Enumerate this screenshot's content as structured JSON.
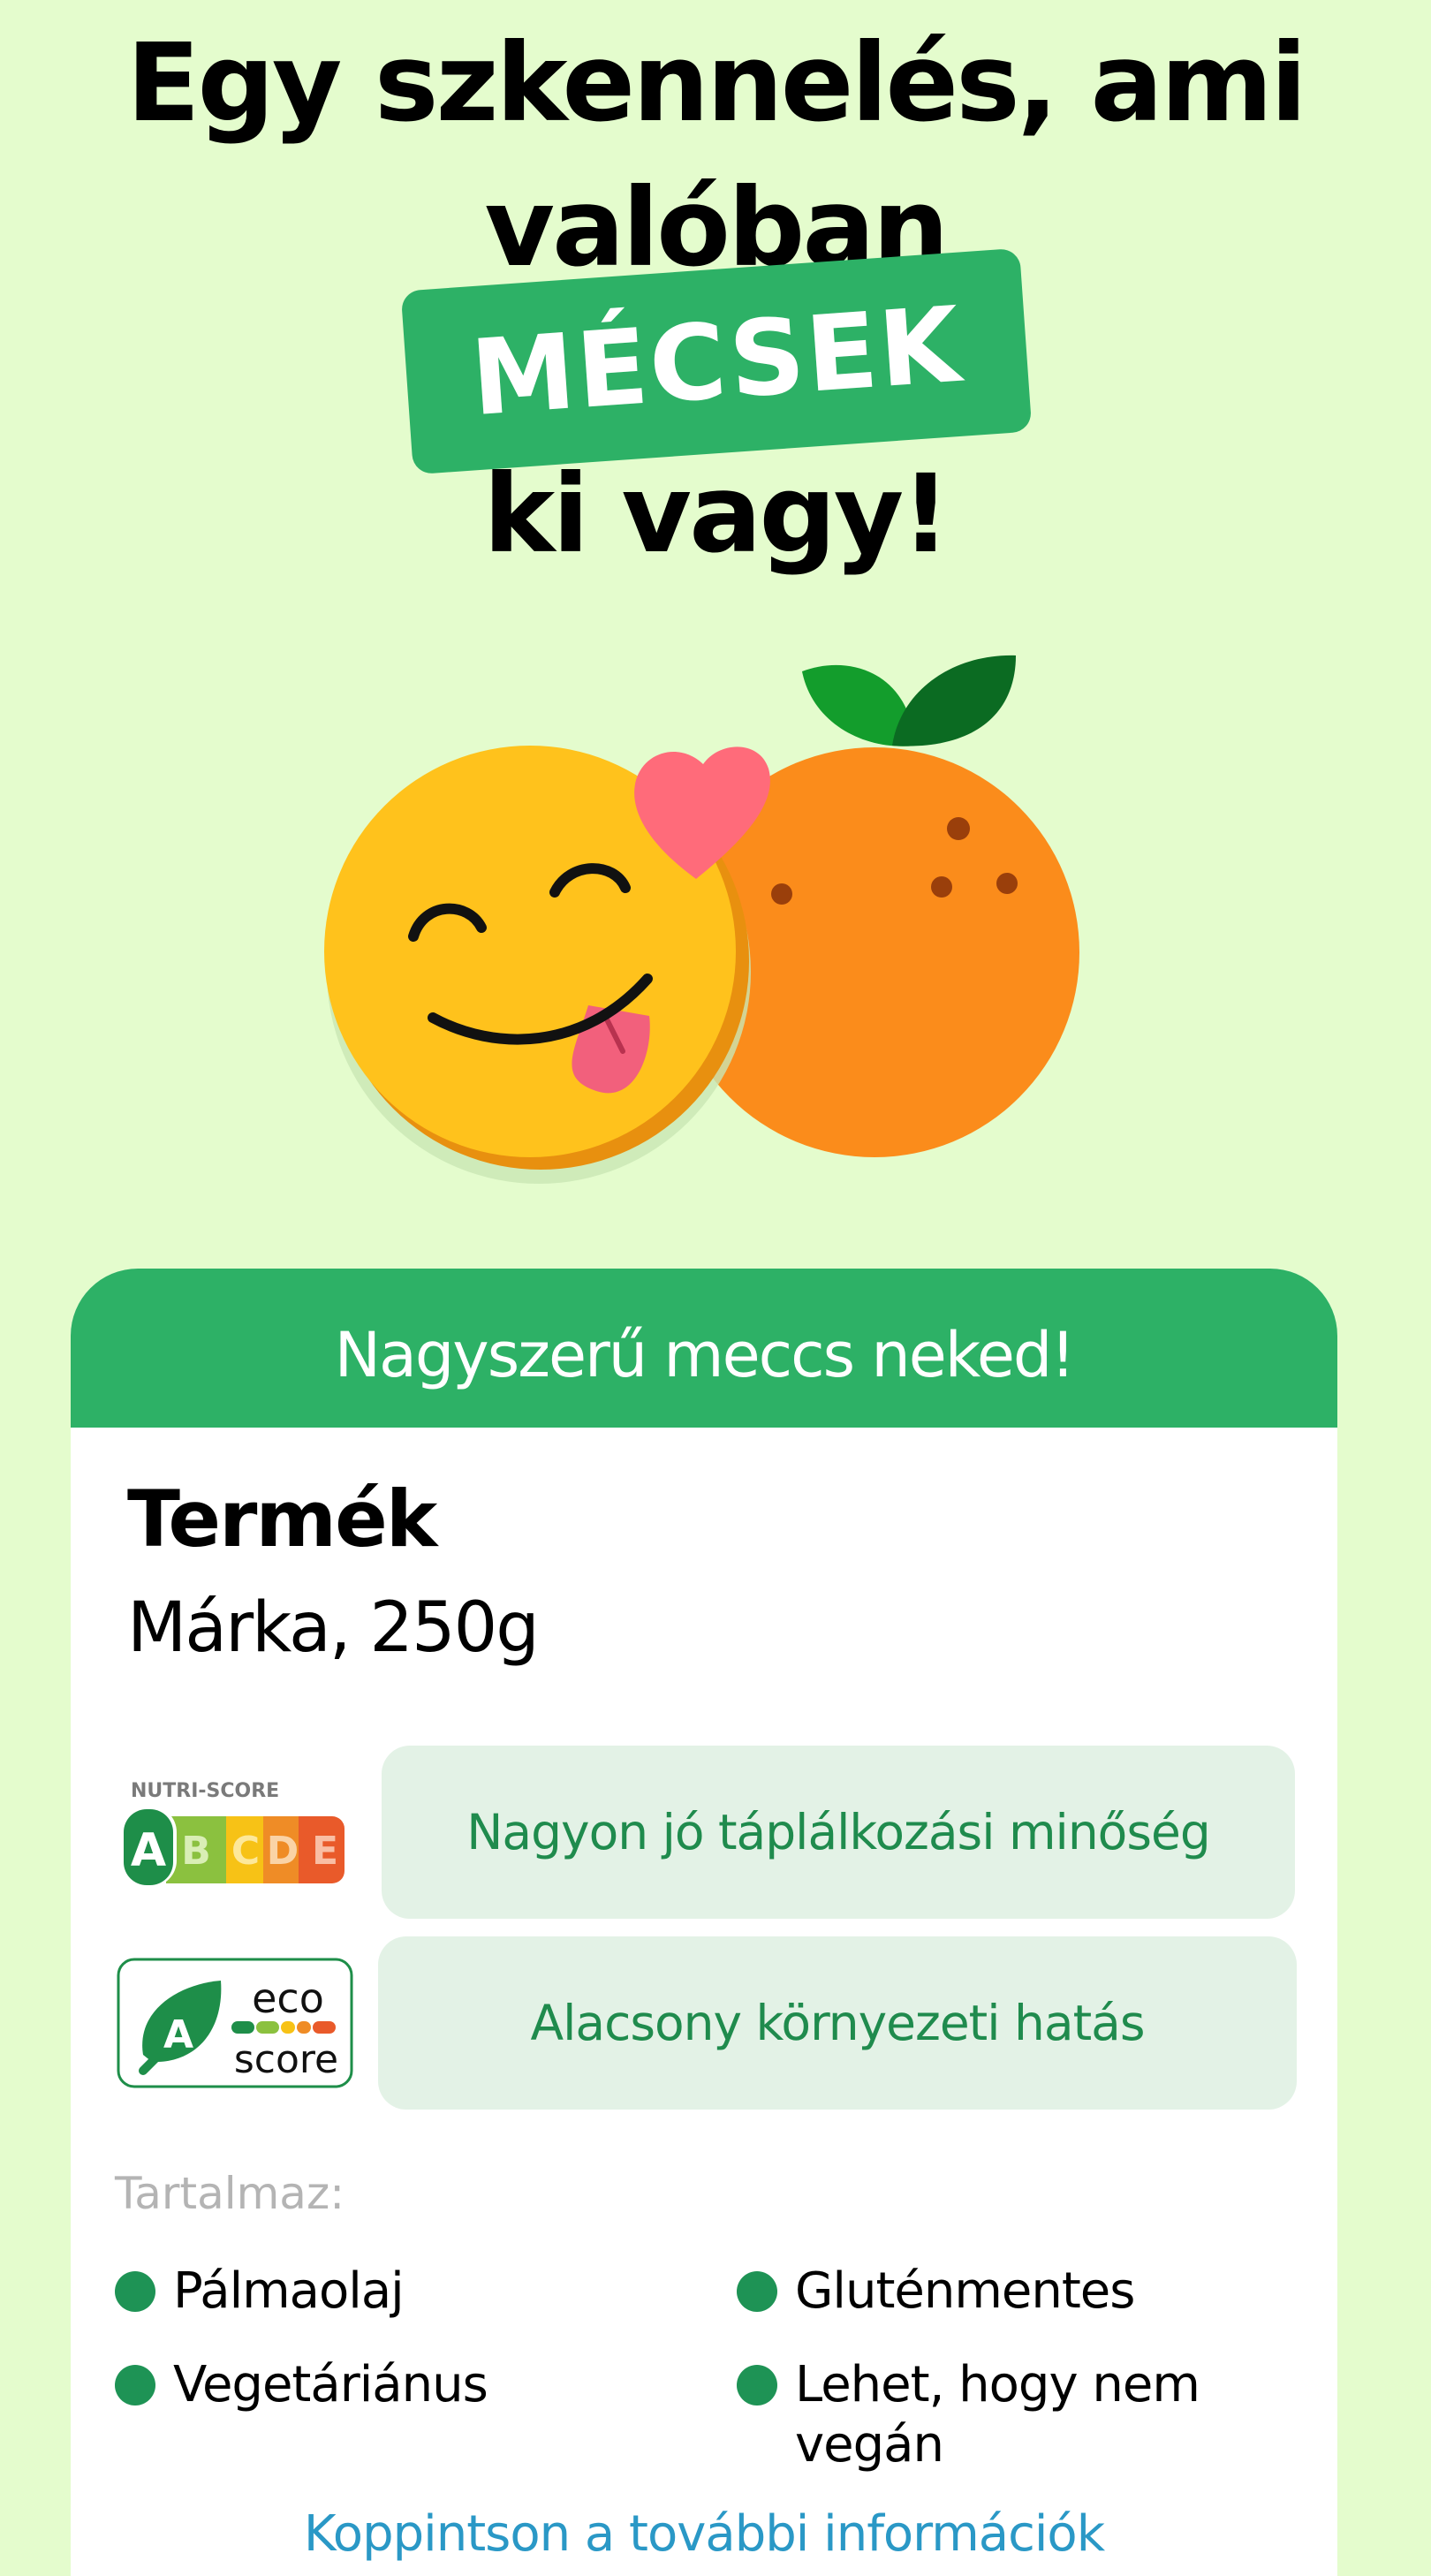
{
  "headline": {
    "line1": "Egy szkennelés, ami",
    "line2": "valóban",
    "badge": "MÉCSEK",
    "line3": "ki vagy!"
  },
  "illustration": {
    "smiley_icon": "smiley-tongue-icon",
    "heart_icon": "heart-icon",
    "orange_icon": "orange-fruit-icon"
  },
  "card": {
    "header": "Nagyszerű meccs neked!",
    "product_name": "Termék",
    "product_brand": "Márka, 250g",
    "nutri_score": {
      "logo_title": "NUTRI-SCORE",
      "grades": [
        "A",
        "B",
        "C",
        "D",
        "E"
      ],
      "selected": "A",
      "description": "Nagyon jó táplálkozási minőség"
    },
    "eco_score": {
      "grade": "A",
      "word1": "eco",
      "word2": "score",
      "description": "Alacsony környezeti hatás"
    },
    "contains_label": "Tartalmaz:",
    "features": [
      "Pálmaolaj",
      "Gluténmentes",
      "Vegetáriánus",
      "Lehet, hogy nem vegán"
    ],
    "more_link": "Koppintson a további információk"
  },
  "colors": {
    "background": "#e4fccd",
    "brand_green": "#2db166",
    "text_green": "#1f8b4d",
    "pill_background": "#e3f2e6",
    "link_blue": "#2a98c6"
  }
}
